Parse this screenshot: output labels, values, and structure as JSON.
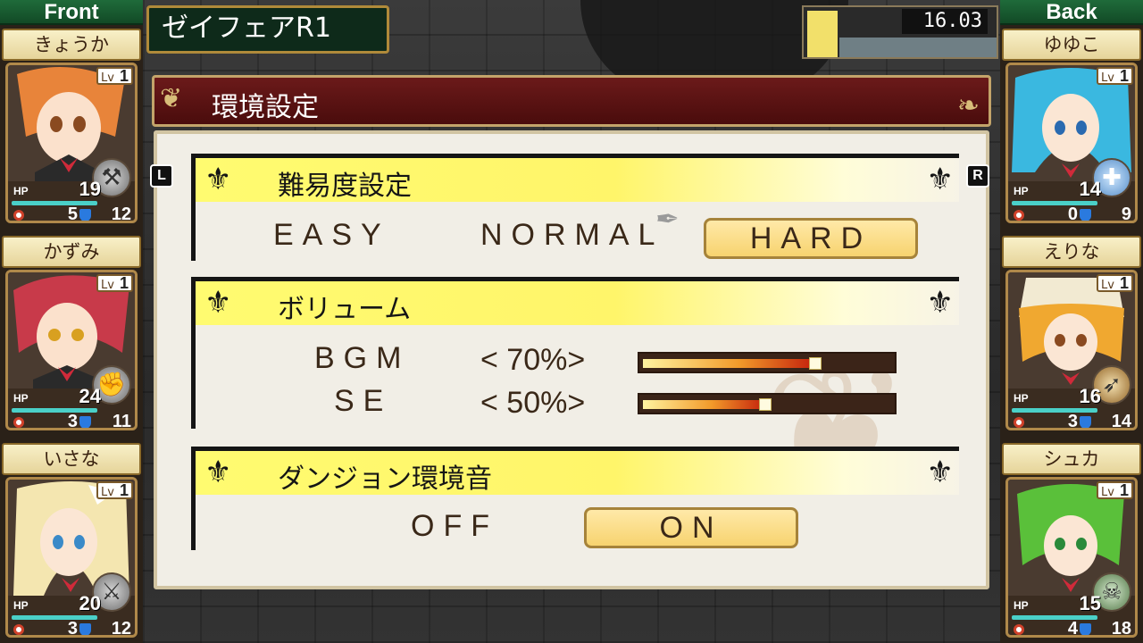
{
  "dungeon": {
    "name": "ゼイフェアR1"
  },
  "timer": {
    "value": "16.03"
  },
  "party": {
    "front_label": "Front",
    "back_label": "Back",
    "front": [
      {
        "name": "きょうか",
        "lv_label": "Lv",
        "level": "1",
        "hp_label": "HP",
        "hp": "19",
        "atk": "5",
        "def": "12",
        "weapon_icon": "axe-icon"
      },
      {
        "name": "かずみ",
        "lv_label": "Lv",
        "level": "1",
        "hp_label": "HP",
        "hp": "24",
        "atk": "3",
        "def": "11",
        "weapon_icon": "fist-icon"
      },
      {
        "name": "いさな",
        "lv_label": "Lv",
        "level": "1",
        "hp_label": "HP",
        "hp": "20",
        "atk": "3",
        "def": "12",
        "weapon_icon": "sword-icon"
      }
    ],
    "back": [
      {
        "name": "ゆゆこ",
        "lv_label": "Lv",
        "level": "1",
        "hp_label": "HP",
        "hp": "14",
        "atk": "0",
        "def": "9",
        "weapon_icon": "cross-icon"
      },
      {
        "name": "えりな",
        "lv_label": "Lv",
        "level": "1",
        "hp_label": "HP",
        "hp": "16",
        "atk": "3",
        "def": "14",
        "weapon_icon": "bow-icon"
      },
      {
        "name": "シュカ",
        "lv_label": "Lv",
        "level": "1",
        "hp_label": "HP",
        "hp": "15",
        "atk": "4",
        "def": "18",
        "weapon_icon": "skull-staff-icon"
      }
    ]
  },
  "settings": {
    "title": "環境設定",
    "nav_left": "L",
    "nav_right": "R",
    "difficulty": {
      "title": "難易度設定",
      "options": [
        "EASY",
        "NORMAL",
        "HARD"
      ],
      "selected": "HARD"
    },
    "volume": {
      "title": "ボリューム",
      "bgm": {
        "label": "BGM",
        "value_text": "< 70%>",
        "level": 0.7
      },
      "se": {
        "label": "SE",
        "value_text": "< 50%>",
        "level": 0.5
      }
    },
    "ambient": {
      "title": "ダンジョン環境音",
      "options": [
        "OFF",
        "ON"
      ],
      "selected": "ON"
    }
  },
  "colors": {
    "title_bar": "#5a1212",
    "section_highlight": "#fff56a",
    "selected_button": "#f7d36f",
    "hp_bar": "#4ad0c8"
  }
}
